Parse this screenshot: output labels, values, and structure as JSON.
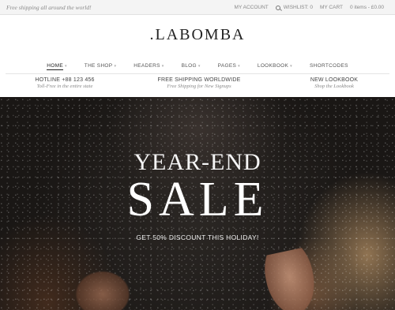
{
  "topbar": {
    "notice": "Free shipping all around the world!",
    "my_account": "MY ACCOUNT",
    "wishlist": "WISHLIST: 0",
    "cart": "MY CART",
    "cart_items": "0 items - £0.00"
  },
  "logo": ".LABOMBA",
  "nav": {
    "items": [
      "HOME",
      "THE SHOP",
      "HEADERS",
      "BLOG",
      "PAGES",
      "LOOKBOOK",
      "SHORTCODES"
    ]
  },
  "info": [
    {
      "title": "HOTLINE +88 123 456",
      "subtitle": "Toll-Free in the entire state"
    },
    {
      "title": "FREE SHIPPING WORLDWIDE",
      "subtitle": "Free Shipping for New Signups"
    },
    {
      "title": "NEW LOOKBOOK",
      "subtitle": "Shop the Lookbook"
    }
  ],
  "hero": {
    "line1": "YEAR-END",
    "line2": "SALE",
    "subtitle": "GET 50% DISCOUNT THIS HOLIDAY!"
  },
  "icons": [
    "search-icon",
    "caret-down-icon"
  ],
  "colors": {
    "topbar_bg": "#f4f4f4",
    "hero_text": "#ffffff"
  }
}
